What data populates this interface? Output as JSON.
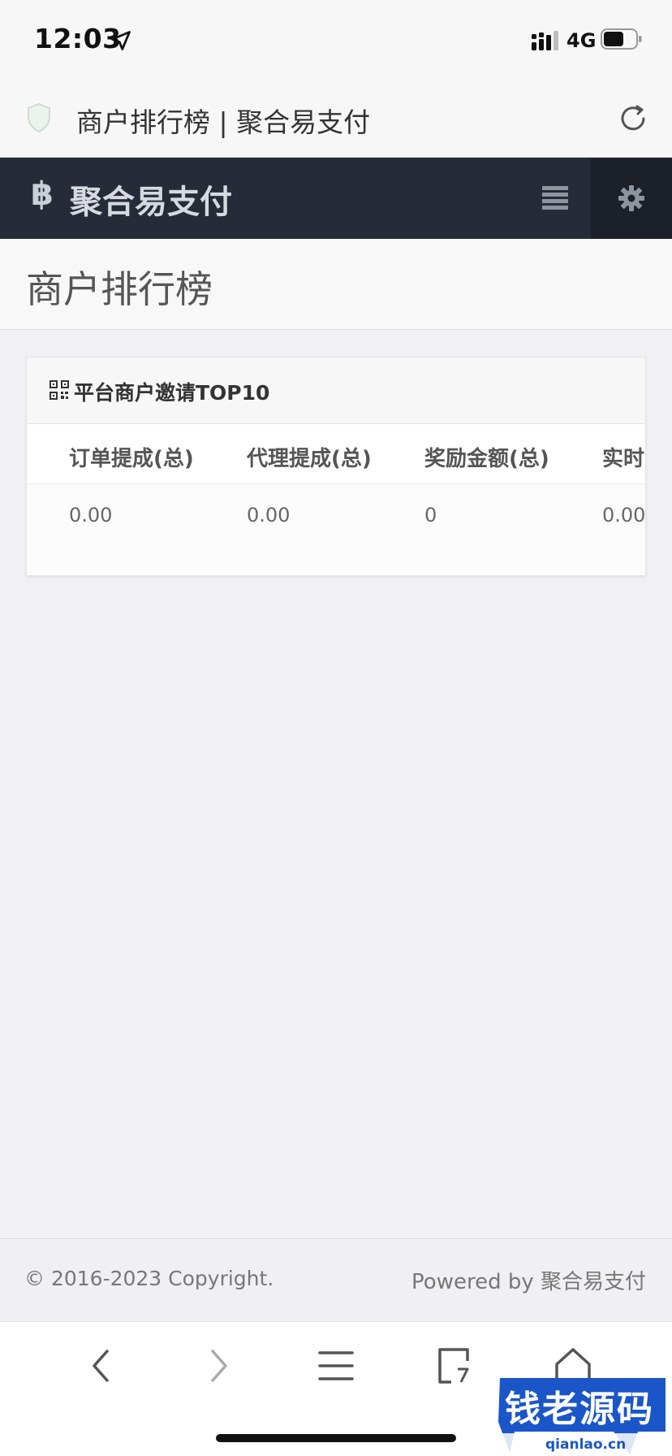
{
  "status_bar": {
    "time": "12:03",
    "network": "4G"
  },
  "browser": {
    "url_title": "商户排行榜 | 聚合易支付"
  },
  "navbar": {
    "brand_icon": "฿",
    "brand": "聚合易支付"
  },
  "page": {
    "title": "商户排行榜"
  },
  "panel": {
    "title": "平台商户邀请TOP10",
    "columns": [
      "订单提成(总)",
      "代理提成(总)",
      "奖励金额(总)",
      "实时"
    ],
    "rows": [
      [
        "0.00",
        "0.00",
        "0",
        "0.00"
      ]
    ]
  },
  "footer": {
    "copyright": "© 2016-2023 Copyright.",
    "powered": "Powered by 聚合易支付"
  },
  "watermark": {
    "text": "钱老源码",
    "sub": "qianlao.cn"
  },
  "colors": {
    "navbar_bg": "#252b37",
    "settings_bg": "#1c2029",
    "page_bg": "#f1f1f3"
  },
  "icons": [
    "location-arrow-icon",
    "signal-icon",
    "battery-icon",
    "shield-icon",
    "reload-icon",
    "bitcoin-icon",
    "menu-icon",
    "gear-icon",
    "qrcode-icon",
    "back-icon",
    "forward-icon",
    "hamburger-icon",
    "tabs-icon",
    "home-icon"
  ]
}
